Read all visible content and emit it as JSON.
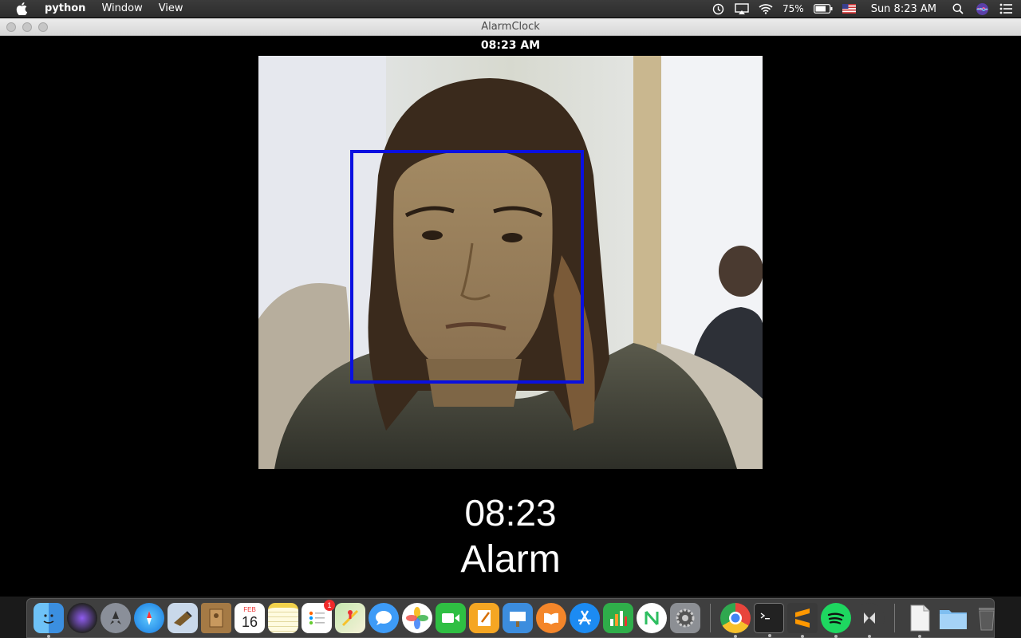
{
  "menubar": {
    "app_name": "python",
    "menus": [
      "Window",
      "View"
    ],
    "battery_percent": "75%",
    "clock": "Sun 8:23 AM",
    "status_icons": [
      "timemachine-icon",
      "airplay-icon",
      "wifi-icon",
      "battery-icon",
      "input-flag-icon",
      "spotlight-icon",
      "siri-icon",
      "notification-center-icon"
    ]
  },
  "window": {
    "title": "AlarmClock"
  },
  "app": {
    "top_time": "08:23 AM",
    "big_time": "08:23",
    "alarm_label": "Alarm",
    "face_box_color": "#0a10e0"
  },
  "dock": {
    "reminders_badge": "1",
    "calendar_month": "FEB",
    "calendar_day": "16",
    "icons": [
      "finder-icon",
      "siri-icon",
      "launchpad-icon",
      "safari-icon",
      "mail-icon",
      "contacts-icon",
      "calendar-icon",
      "notes-icon",
      "reminders-icon",
      "maps-icon",
      "messages-icon",
      "photos-icon",
      "facetime-icon",
      "pages-icon",
      "keynote-icon",
      "ibooks-icon",
      "app-store-icon",
      "numbers-icon",
      "evernote-icon",
      "system-preferences-icon",
      "chrome-icon",
      "terminal-icon",
      "sublime-text-icon",
      "spotify-icon",
      "kivy-icon",
      "python-document-icon",
      "folder-icon",
      "trash-icon"
    ]
  }
}
